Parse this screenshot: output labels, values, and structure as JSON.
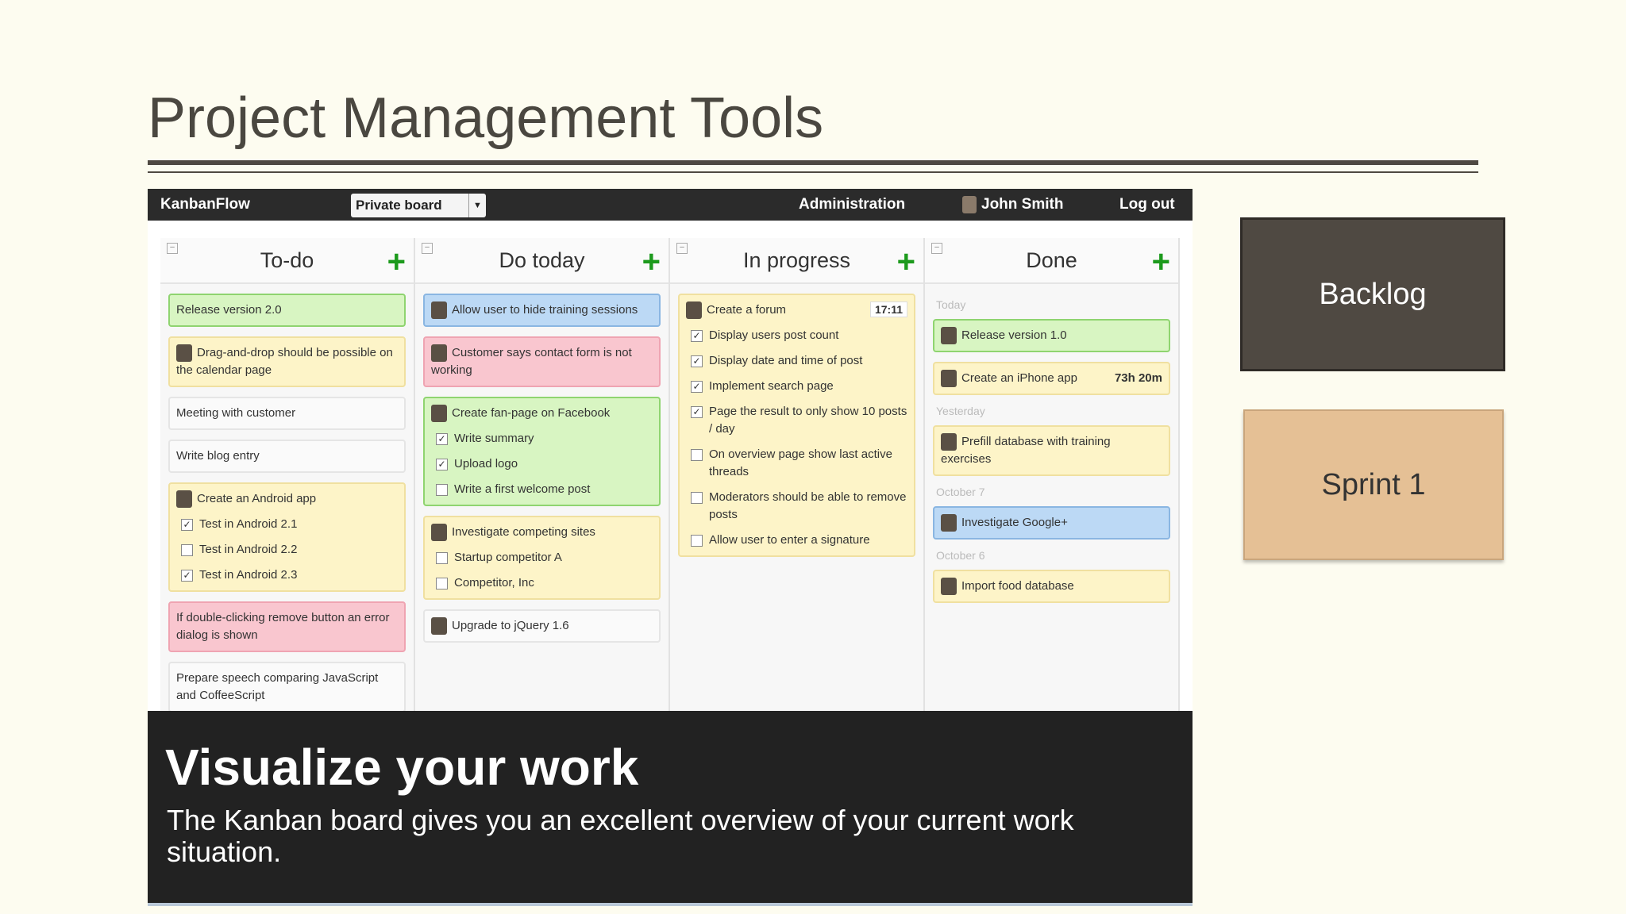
{
  "slide": {
    "title": "Project Management Tools",
    "boxes": {
      "backlog": "Backlog",
      "sprint": "Sprint 1"
    }
  },
  "app": {
    "brand": "KanbanFlow",
    "board_select": "Private board",
    "nav": {
      "admin": "Administration",
      "user": "John Smith",
      "logout": "Log out"
    },
    "columns": [
      {
        "title": "To-do"
      },
      {
        "title": "Do today"
      },
      {
        "title": "In progress"
      },
      {
        "title": "Done"
      }
    ],
    "todo": {
      "c1": "Release version 2.0",
      "c2": "Drag-and-drop should be possible on the calendar page",
      "c3": "Meeting with customer",
      "c4": "Write blog entry",
      "c5": "Create an Android app",
      "c5_sub": [
        "Test in Android 2.1",
        "Test in Android 2.2",
        "Test in Android 2.3"
      ],
      "c6": "If double-clicking remove button an error dialog is shown",
      "c7": "Prepare speech comparing JavaScript and CoffeeScript"
    },
    "today": {
      "c1": "Allow user to hide training sessions",
      "c2": "Customer says contact form is not working",
      "c3": "Create fan-page on Facebook",
      "c3_sub": [
        "Write summary",
        "Upload logo",
        "Write a first welcome post"
      ],
      "c4": "Investigate competing sites",
      "c4_sub": [
        "Startup competitor A",
        "Competitor, Inc"
      ],
      "c5": "Upgrade to jQuery 1.6"
    },
    "progress": {
      "c1": "Create a forum",
      "c1_badge": "17:11",
      "c1_sub": [
        "Display users post count",
        "Display date and time of post",
        "Implement search page",
        "Page the result to only show 10 posts / day",
        "On overview page show last active threads",
        "Moderators should be able to remove posts",
        "Allow user to enter a signature"
      ]
    },
    "done": {
      "d1": "Today",
      "c1": "Release version 1.0",
      "c2": "Create an iPhone app",
      "c2_time": "73h 20m",
      "d2": "Yesterday",
      "c3": "Prefill database with training exercises",
      "d3": "October 7",
      "c4": "Investigate Google+",
      "d4": "October 6",
      "c5": "Import food database"
    },
    "overlay": {
      "title": "Visualize your work",
      "text": "The Kanban board gives you an excellent overview of your current work situation."
    }
  }
}
